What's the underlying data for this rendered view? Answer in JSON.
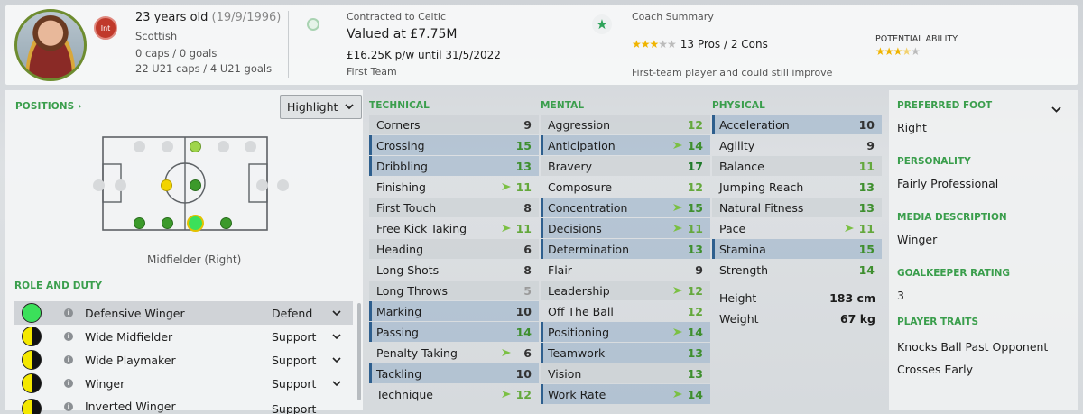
{
  "header": {
    "age": "23 years old",
    "dob": "(19/9/1996)",
    "nationality": "Scottish",
    "caps": "0 caps / 0 goals",
    "u21": "22 U21 caps / 4 U21 goals",
    "flag_text": "Int",
    "contract_label": "Contracted to Celtic",
    "value": "Valued at £7.75M",
    "wage": "£16.25K p/w until 31/5/2022",
    "squad": "First Team",
    "coach_label": "Coach Summary",
    "pros_cons": "13 Pros / 2 Cons",
    "coach_note": "First-team player and could still improve",
    "potential_label": "POTENTIAL ABILITY",
    "current_stars": 3,
    "potential_stars": 3.5
  },
  "positions": {
    "title": "POSITIONS",
    "highlight": "Highlight",
    "position_name": "Midfielder (Right)"
  },
  "roles": {
    "title": "ROLE AND DUTY",
    "items": [
      {
        "name": "Defensive Winger",
        "duty": "Defend"
      },
      {
        "name": "Wide Midfielder",
        "duty": "Support"
      },
      {
        "name": "Wide Playmaker",
        "duty": "Support"
      },
      {
        "name": "Winger",
        "duty": "Support"
      },
      {
        "name": "Inverted Winger",
        "duty": "Support"
      }
    ]
  },
  "technical": {
    "title": "TECHNICAL",
    "items": [
      {
        "name": "Corners",
        "value": "9"
      },
      {
        "name": "Crossing",
        "value": "15"
      },
      {
        "name": "Dribbling",
        "value": "13"
      },
      {
        "name": "Finishing",
        "value": "11"
      },
      {
        "name": "First Touch",
        "value": "8"
      },
      {
        "name": "Free Kick Taking",
        "value": "11"
      },
      {
        "name": "Heading",
        "value": "6"
      },
      {
        "name": "Long Shots",
        "value": "8"
      },
      {
        "name": "Long Throws",
        "value": "5"
      },
      {
        "name": "Marking",
        "value": "10"
      },
      {
        "name": "Passing",
        "value": "14"
      },
      {
        "name": "Penalty Taking",
        "value": "6"
      },
      {
        "name": "Tackling",
        "value": "10"
      },
      {
        "name": "Technique",
        "value": "12"
      }
    ]
  },
  "mental": {
    "title": "MENTAL",
    "items": [
      {
        "name": "Aggression",
        "value": "12"
      },
      {
        "name": "Anticipation",
        "value": "14"
      },
      {
        "name": "Bravery",
        "value": "17"
      },
      {
        "name": "Composure",
        "value": "12"
      },
      {
        "name": "Concentration",
        "value": "15"
      },
      {
        "name": "Decisions",
        "value": "11"
      },
      {
        "name": "Determination",
        "value": "13"
      },
      {
        "name": "Flair",
        "value": "9"
      },
      {
        "name": "Leadership",
        "value": "12"
      },
      {
        "name": "Off The Ball",
        "value": "12"
      },
      {
        "name": "Positioning",
        "value": "14"
      },
      {
        "name": "Teamwork",
        "value": "13"
      },
      {
        "name": "Vision",
        "value": "13"
      },
      {
        "name": "Work Rate",
        "value": "14"
      }
    ]
  },
  "physical": {
    "title": "PHYSICAL",
    "items": [
      {
        "name": "Acceleration",
        "value": "10"
      },
      {
        "name": "Agility",
        "value": "9"
      },
      {
        "name": "Balance",
        "value": "11"
      },
      {
        "name": "Jumping Reach",
        "value": "13"
      },
      {
        "name": "Natural Fitness",
        "value": "13"
      },
      {
        "name": "Pace",
        "value": "11"
      },
      {
        "name": "Stamina",
        "value": "15"
      },
      {
        "name": "Strength",
        "value": "14"
      }
    ],
    "height_label": "Height",
    "height": "183 cm",
    "weight_label": "Weight",
    "weight": "67 kg"
  },
  "side": {
    "foot_label": "PREFERRED FOOT",
    "foot": "Right",
    "personality_label": "PERSONALITY",
    "personality": "Fairly Professional",
    "media_label": "MEDIA DESCRIPTION",
    "media": "Winger",
    "gk_label": "GOALKEEPER RATING",
    "gk": "3",
    "traits_label": "PLAYER TRAITS",
    "trait1": "Knocks Ball Past Opponent",
    "trait2": "Crosses Early"
  }
}
